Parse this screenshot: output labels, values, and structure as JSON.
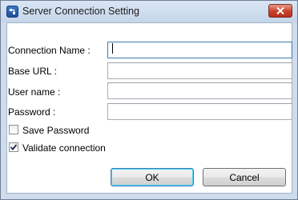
{
  "window": {
    "title": "Server Connection Setting",
    "icons": {
      "app": "app-logo-icon",
      "close": "close-icon"
    }
  },
  "form": {
    "connection_name": {
      "label": "Connection Name :",
      "value": ""
    },
    "base_url": {
      "label": "Base URL :",
      "value": ""
    },
    "user_name": {
      "label": "User name :",
      "value": ""
    },
    "password": {
      "label": "Password :",
      "value": ""
    }
  },
  "options": {
    "save_password": {
      "label": "Save Password",
      "checked": false
    },
    "validate_connection": {
      "label": "Validate connection",
      "checked": true
    }
  },
  "buttons": {
    "ok": "OK",
    "cancel": "Cancel"
  },
  "colors": {
    "title_bar": "#cfdcec",
    "close_button": "#c9402a",
    "default_button_border": "#3c7fb1"
  }
}
